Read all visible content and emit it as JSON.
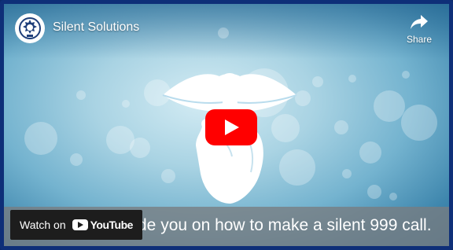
{
  "video": {
    "title": "Silent Solutions",
    "caption": "de you on how to make a silent 999 call."
  },
  "share": {
    "label": "Share",
    "icon": "share-arrow-icon"
  },
  "player": {
    "play_icon": "play-icon",
    "accent": "#ff0000"
  },
  "watch_on": {
    "label": "Watch on",
    "brand": "YouTube",
    "icon": "youtube-logo-icon"
  },
  "channel": {
    "icon": "police-crest-icon"
  }
}
